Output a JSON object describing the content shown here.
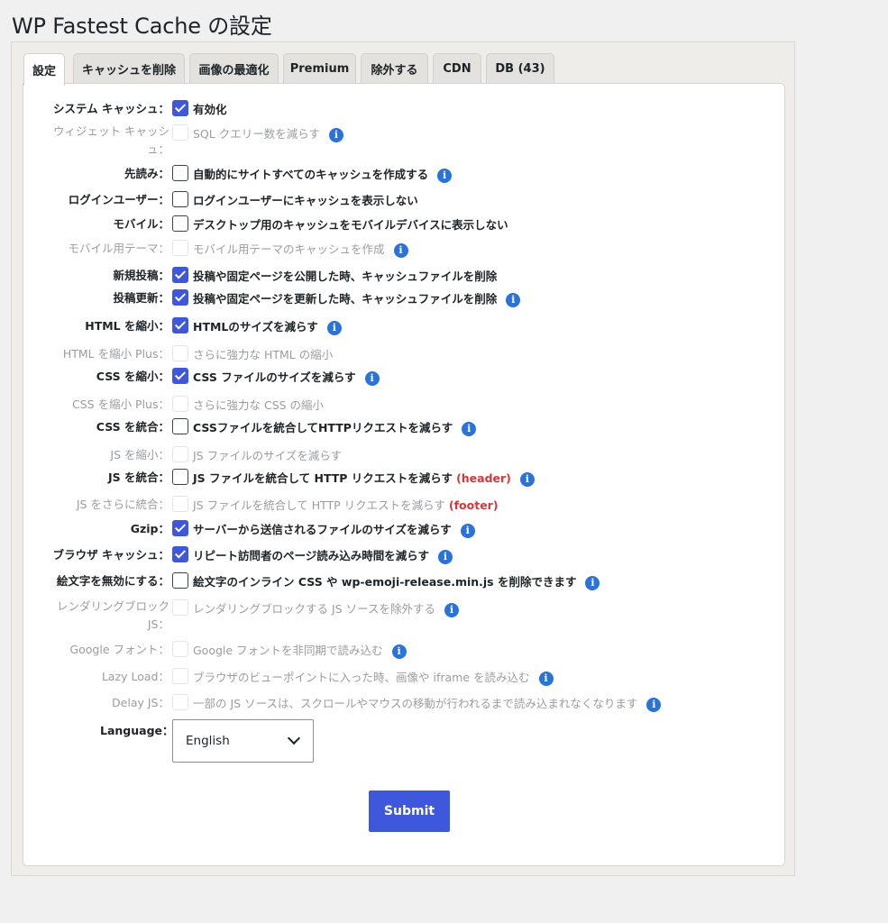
{
  "page_title": "WP Fastest Cache の設定",
  "tabs": [
    {
      "label": "設定",
      "active": true
    },
    {
      "label": "キャッシュを削除"
    },
    {
      "label": "画像の最適化"
    },
    {
      "label": "Premium"
    },
    {
      "label": "除外する"
    },
    {
      "label": "CDN"
    },
    {
      "label": "DB (43)"
    }
  ],
  "settings": [
    {
      "label": "システム キャッシュ：",
      "option": "有効化",
      "checked": true,
      "disabled": false,
      "info": false
    },
    {
      "label": "ウィジェット キャッシュ：",
      "option": "SQL クエリー数を減らす",
      "checked": false,
      "disabled": true,
      "info": true
    },
    {
      "label": "先読み：",
      "option": "自動的にサイトすべてのキャッシュを作成する",
      "checked": false,
      "disabled": false,
      "info": true
    },
    {
      "label": "ログインユーザー：",
      "option": "ログインユーザーにキャッシュを表示しない",
      "checked": false,
      "disabled": false,
      "info": false
    },
    {
      "label": "モバイル：",
      "option": "デスクトップ用のキャッシュをモバイルデバイスに表示しない",
      "checked": false,
      "disabled": false,
      "info": false
    },
    {
      "label": "モバイル用テーマ：",
      "option": "モバイル用テーマのキャッシュを作成",
      "checked": false,
      "disabled": true,
      "info": true
    },
    {
      "label": "新規投稿：",
      "option": "投稿や固定ページを公開した時、キャッシュファイルを削除",
      "checked": true,
      "disabled": false,
      "info": false
    },
    {
      "label": "投稿更新：",
      "option": "投稿や固定ページを更新した時、キャッシュファイルを削除",
      "checked": true,
      "disabled": false,
      "info": true
    },
    {
      "label": "HTML を縮小：",
      "option": "HTMLのサイズを減らす",
      "checked": true,
      "disabled": false,
      "info": true
    },
    {
      "label": "HTML を縮小 Plus：",
      "option": "さらに強力な HTML の縮小",
      "checked": false,
      "disabled": true,
      "info": false
    },
    {
      "label": "CSS を縮小：",
      "option": "CSS ファイルのサイズを減らす",
      "checked": true,
      "disabled": false,
      "info": true
    },
    {
      "label": "CSS を縮小 Plus：",
      "option": "さらに強力な CSS の縮小",
      "checked": false,
      "disabled": true,
      "info": false
    },
    {
      "label": "CSS を統合：",
      "option": "CSSファイルを統合してHTTPリクエストを減らす",
      "checked": false,
      "disabled": false,
      "info": true
    },
    {
      "label": "JS を縮小：",
      "option": "JS ファイルのサイズを減らす",
      "checked": false,
      "disabled": true,
      "info": false
    },
    {
      "label": "JS を統合：",
      "option": "JS ファイルを統合して HTTP リクエストを減らす",
      "tag": "(header)",
      "checked": false,
      "disabled": false,
      "info": true
    },
    {
      "label": "JS をさらに統合：",
      "option": "JS ファイルを統合して HTTP リクエストを減らす",
      "tag": "(footer)",
      "checked": false,
      "disabled": true,
      "info": false
    },
    {
      "label": "Gzip：",
      "option": "サーバーから送信されるファイルのサイズを減らす",
      "checked": true,
      "disabled": false,
      "info": true
    },
    {
      "label": "ブラウザ キャッシュ：",
      "option": "リピート訪問者のページ読み込み時間を減らす",
      "checked": true,
      "disabled": false,
      "info": true
    },
    {
      "label": "絵文字を無効にする：",
      "option": "絵文字のインライン CSS や wp-emoji-release.min.js を削除できます",
      "checked": false,
      "disabled": false,
      "info": true
    },
    {
      "label": "レンダリングブロック JS：",
      "option": "レンダリングブロックする JS ソースを除外する",
      "checked": false,
      "disabled": true,
      "info": true
    },
    {
      "label": "Google フォント：",
      "option": "Google フォントを非同期で読み込む",
      "checked": false,
      "disabled": true,
      "info": true
    },
    {
      "label": "Lazy Load：",
      "option": "ブラウザのビューポイントに入った時、画像や iframe を読み込む",
      "checked": false,
      "disabled": true,
      "info": true
    },
    {
      "label": "Delay JS：",
      "option": "一部の JS ソースは、スクロールやマウスの移動が行われるまで読み込まれなくなります",
      "checked": false,
      "disabled": true,
      "info": true
    }
  ],
  "language": {
    "label": "Language：",
    "selected": "English"
  },
  "submit_label": "Submit",
  "colors": {
    "accent": "#3f57db",
    "info": "#2a73d9",
    "tag_red": "#d63638"
  },
  "icons": {
    "info": "info-circle-icon",
    "checkbox": "checkmark-icon",
    "dropdown": "chevron-down-icon"
  }
}
